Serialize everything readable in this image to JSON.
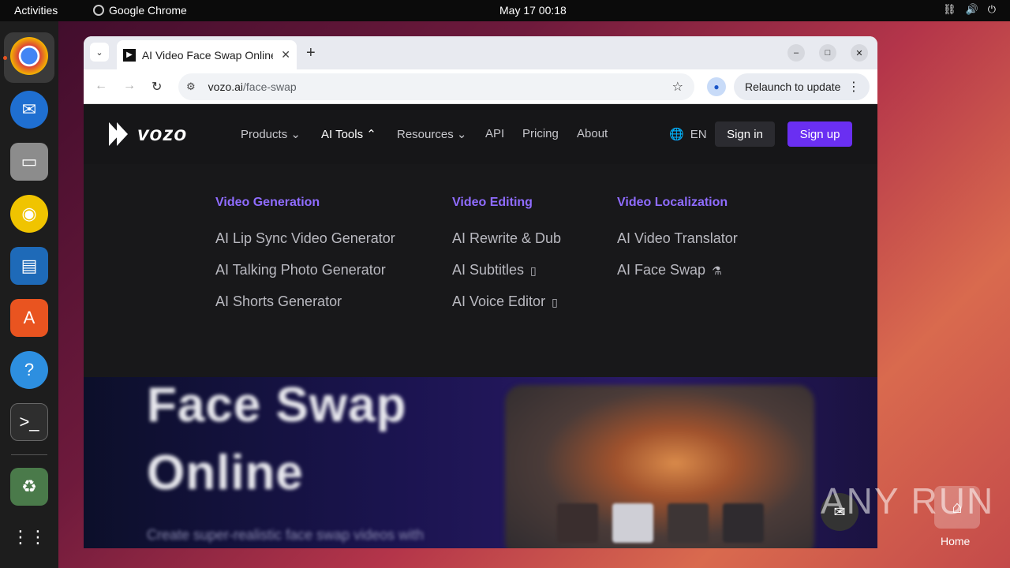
{
  "topbar": {
    "activities": "Activities",
    "app_name": "Google Chrome",
    "clock": "May 17  00:18",
    "tray": [
      "network-icon",
      "volume-icon",
      "power-icon"
    ]
  },
  "dock": {
    "apps": [
      "Google Chrome",
      "Thunderbird Mail",
      "Files",
      "Rhythmbox",
      "LibreOffice Writer",
      "Ubuntu Software",
      "Help",
      "Terminal",
      "Trash",
      "Show Applications"
    ]
  },
  "browser": {
    "tab_title": "AI Video Face Swap Online",
    "url_host": "vozo.ai",
    "url_path": "/face-swap",
    "relaunch": "Relaunch to update"
  },
  "site": {
    "logo": "vozo",
    "nav": {
      "products": "Products",
      "ai_tools": "AI Tools",
      "resources": "Resources",
      "api": "API",
      "pricing": "Pricing",
      "about": "About"
    },
    "lang": "EN",
    "sign_in": "Sign in",
    "sign_up": "Sign up",
    "menu": {
      "col1_head": "Video Generation",
      "col1_items": [
        "AI Lip Sync Video Generator",
        "AI Talking Photo Generator",
        "AI Shorts Generator"
      ],
      "col2_head": "Video Editing",
      "col2_items": [
        "AI Rewrite & Dub",
        "AI Subtitles",
        "AI Voice Editor"
      ],
      "col3_head": "Video Localization",
      "col3_items": [
        "AI Video Translator",
        "AI Face Swap"
      ]
    },
    "hero": {
      "title_line1": "Face Swap",
      "title_line2": "Online",
      "subtitle": "Create super-realistic face swap videos with"
    }
  },
  "desktop": {
    "home_label": "Home",
    "watermark": "ANY RUN"
  },
  "colors": {
    "accent": "#6a2ff2",
    "menu_head": "#8f6cff",
    "ubuntu_orange": "#e95420"
  }
}
